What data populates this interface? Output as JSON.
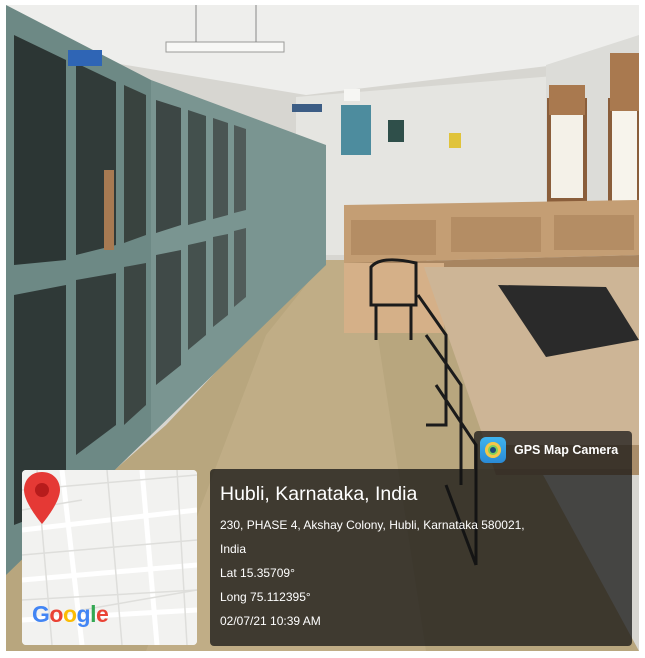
{
  "overlay": {
    "badge_label": "GPS Map Camera",
    "badge_icon": "gps-map-camera-icon",
    "place_title": "Hubli, Karnataka, India",
    "address_line_1": "230, PHASE 4, Akshay Colony, Hubli, Karnataka 580021,",
    "address_line_2": "India",
    "latitude": "Lat 15.35709°",
    "longitude": "Long 75.112395°",
    "timestamp": "02/07/21 10:39 AM"
  },
  "map": {
    "logo_text": "Google",
    "pin_icon": "map-pin-icon",
    "pin_color": "#e53935"
  },
  "colors": {
    "cabinet": "#6f8a86",
    "desk_wood": "#c8a27a",
    "floor": "#b9a77e",
    "wall": "#e6e6e2"
  }
}
